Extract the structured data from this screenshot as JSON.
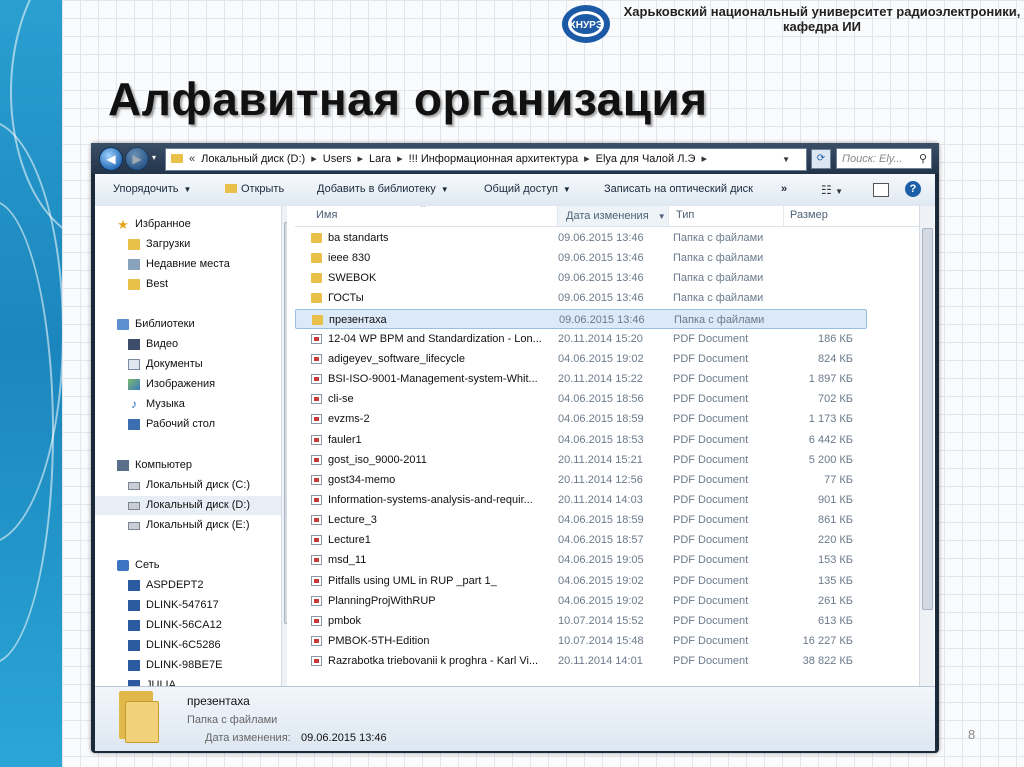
{
  "header": {
    "university_line1": "Харьковский национальный университет радиоэлектроники,",
    "university_line2": "кафедра ИИ",
    "logo_text": "ХНУРЭ"
  },
  "slide": {
    "title": "Алфавитная организация",
    "page_number": "8"
  },
  "explorer": {
    "address": {
      "parts": [
        "Локальный диск (D:)",
        "Users",
        "Lara",
        "!!! Информационная архитектура",
        "Elya для Чалой Л.Э"
      ],
      "search_placeholder": "Поиск: Ely..."
    },
    "toolbar": {
      "organize": "Упорядочить",
      "open": "Открыть",
      "add_to_library": "Добавить в библиотеку",
      "share": "Общий доступ",
      "burn": "Записать на оптический диск",
      "more": "»"
    },
    "nav": {
      "favorites": "Избранное",
      "downloads": "Загрузки",
      "recent": "Недавние места",
      "best": "Best",
      "libraries": "Библиотеки",
      "video": "Видео",
      "documents": "Документы",
      "images": "Изображения",
      "music": "Музыка",
      "desktop": "Рабочий стол",
      "computer": "Компьютер",
      "disk_c": "Локальный диск (C:)",
      "disk_d": "Локальный диск (D:)",
      "disk_e": "Локальный диск (E:)",
      "network": "Сеть",
      "net1": "ASPDEPT2",
      "net2": "DLINK-547617",
      "net3": "DLINK-56CA12",
      "net4": "DLINK-6C5286",
      "net5": "DLINK-98BE7E",
      "net6": "JULIA"
    },
    "columns": {
      "name": "Имя",
      "date": "Дата изменения",
      "type": "Тип",
      "size": "Размер"
    },
    "files": [
      {
        "name": "ba standarts",
        "date": "09.06.2015 13:46",
        "type": "Папка с файлами",
        "size": "",
        "kind": "folder"
      },
      {
        "name": "ieee 830",
        "date": "09.06.2015 13:46",
        "type": "Папка с файлами",
        "size": "",
        "kind": "folder"
      },
      {
        "name": "SWEBOK",
        "date": "09.06.2015 13:46",
        "type": "Папка с файлами",
        "size": "",
        "kind": "folder"
      },
      {
        "name": "ГОСТы",
        "date": "09.06.2015 13:46",
        "type": "Папка с файлами",
        "size": "",
        "kind": "folder"
      },
      {
        "name": "презентаха",
        "date": "09.06.2015 13:46",
        "type": "Папка с файлами",
        "size": "",
        "kind": "folder"
      },
      {
        "name": "12-04 WP BPM and Standardization - Lon...",
        "date": "20.11.2014 15:20",
        "type": "PDF Document",
        "size": "186 КБ",
        "kind": "pdf"
      },
      {
        "name": "adigeyev_software_lifecycle",
        "date": "04.06.2015 19:02",
        "type": "PDF Document",
        "size": "824 КБ",
        "kind": "pdf"
      },
      {
        "name": "BSI-ISO-9001-Management-system-Whit...",
        "date": "20.11.2014 15:22",
        "type": "PDF Document",
        "size": "1 897 КБ",
        "kind": "pdf"
      },
      {
        "name": "cli-se",
        "date": "04.06.2015 18:56",
        "type": "PDF Document",
        "size": "702 КБ",
        "kind": "pdf"
      },
      {
        "name": "evzms-2",
        "date": "04.06.2015 18:59",
        "type": "PDF Document",
        "size": "1 173 КБ",
        "kind": "pdf"
      },
      {
        "name": "fauler1",
        "date": "04.06.2015 18:53",
        "type": "PDF Document",
        "size": "6 442 КБ",
        "kind": "pdf"
      },
      {
        "name": "gost_iso_9000-2011",
        "date": "20.11.2014 15:21",
        "type": "PDF Document",
        "size": "5 200 КБ",
        "kind": "pdf"
      },
      {
        "name": "gost34-memo",
        "date": "20.11.2014 12:56",
        "type": "PDF Document",
        "size": "77 КБ",
        "kind": "pdf"
      },
      {
        "name": "Information-systems-analysis-and-requir...",
        "date": "20.11.2014 14:03",
        "type": "PDF Document",
        "size": "901 КБ",
        "kind": "pdf"
      },
      {
        "name": "Lecture_3",
        "date": "04.06.2015 18:59",
        "type": "PDF Document",
        "size": "861 КБ",
        "kind": "pdf"
      },
      {
        "name": "Lecture1",
        "date": "04.06.2015 18:57",
        "type": "PDF Document",
        "size": "220 КБ",
        "kind": "pdf"
      },
      {
        "name": "msd_11",
        "date": "04.06.2015 19:05",
        "type": "PDF Document",
        "size": "153 КБ",
        "kind": "pdf"
      },
      {
        "name": "Pitfalls using UML in RUP _part 1_",
        "date": "04.06.2015 19:02",
        "type": "PDF Document",
        "size": "135 КБ",
        "kind": "pdf"
      },
      {
        "name": "PlanningProjWithRUP",
        "date": "04.06.2015 19:02",
        "type": "PDF Document",
        "size": "261 КБ",
        "kind": "pdf"
      },
      {
        "name": "pmbok",
        "date": "10.07.2014 15:52",
        "type": "PDF Document",
        "size": "613 КБ",
        "kind": "pdf"
      },
      {
        "name": "PMBOK-5TH-Edition",
        "date": "10.07.2014 15:48",
        "type": "PDF Document",
        "size": "16 227 КБ",
        "kind": "pdf"
      },
      {
        "name": "Razrabotka triebovanii k proghra - Karl Vi...",
        "date": "20.11.2014 14:01",
        "type": "PDF Document",
        "size": "38 822 КБ",
        "kind": "pdf"
      }
    ],
    "details": {
      "name": "презентаха",
      "type": "Папка с файлами",
      "date_label": "Дата изменения:",
      "date_value": "09.06.2015 13:46"
    }
  },
  "colors": {
    "accent_blue": "#1e5ea8",
    "folder_yellow": "#e8c04a",
    "selection": "#dbe9f8"
  }
}
